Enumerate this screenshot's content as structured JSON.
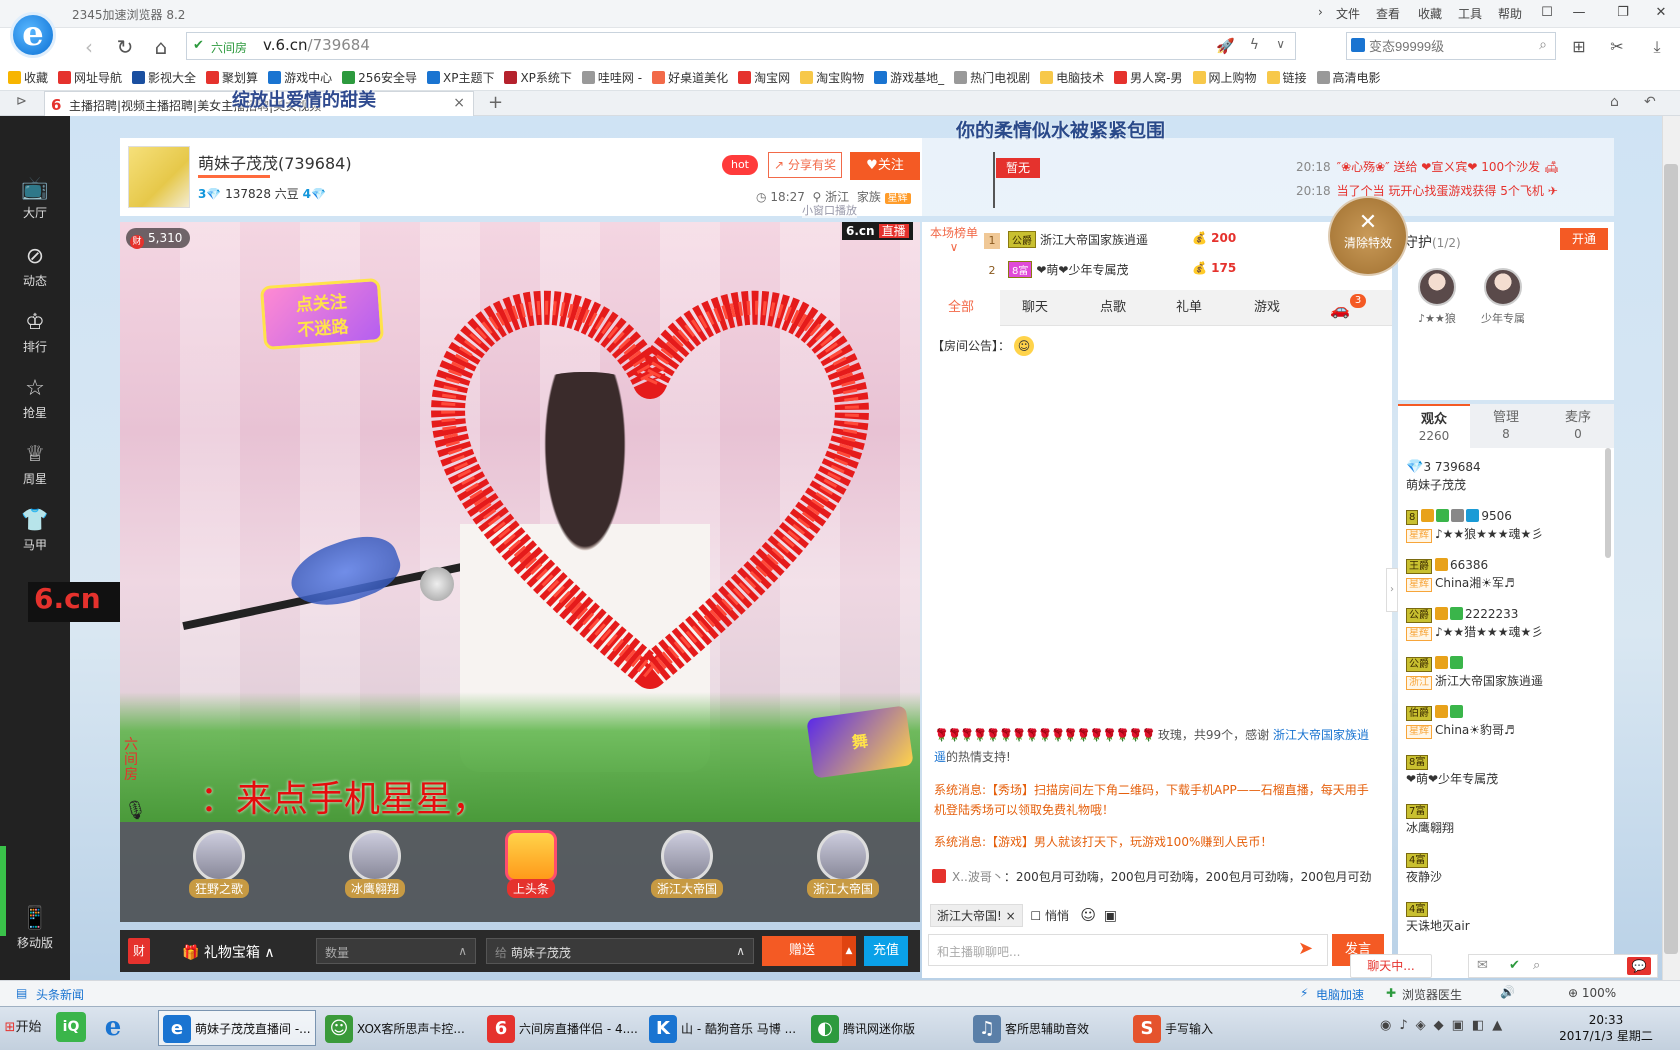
{
  "browser": {
    "title": "2345加速浏览器 8.2",
    "menu": [
      "文件",
      "查看",
      "收藏",
      "工具",
      "帮助"
    ],
    "site_label": "六间房",
    "url_host": "v.6.cn",
    "url_path": "/739684",
    "search_placeholder": "变态99999级",
    "tab_title": "主播招聘|视频主播招聘|美女主播招聘|美女视频",
    "tab_overlay": "绽放出爱情的甜美",
    "bookmarks": [
      "收藏",
      "网址导航",
      "影视大全",
      "聚划算",
      "游戏中心",
      "256安全导",
      "XP主题下",
      "XP系统下",
      "哇哇网 -",
      "好桌道美化",
      "淘宝网",
      "淘宝购物",
      "游戏基地_",
      "热门电视剧",
      "电脑技术",
      "男人窝-男",
      "网上购物",
      "链接",
      "高清电影"
    ],
    "bookmark_colors": [
      "#f7b500",
      "#e5322d",
      "#1a4fa0",
      "#e5322d",
      "#1a74d1",
      "#2d9a3e",
      "#1a74d1",
      "#b5222d",
      "#999",
      "#f26a49",
      "#e5322d",
      "#f7c84a",
      "#1a74d1",
      "#999",
      "#f7c84a",
      "#e5322d",
      "#f7c84a",
      "#f7c84a",
      "#999"
    ]
  },
  "leftnav": [
    "大厅",
    "动态",
    "排行",
    "抢星",
    "周星",
    "马甲"
  ],
  "leftnav_bottom": "移动版",
  "banner": "你的柔情似水被紧紧包围",
  "host": {
    "name": "萌妹子茂茂(739684)",
    "level": "3",
    "beans": "137828 六豆",
    "level2": "4",
    "time": "18:27",
    "location": "浙江",
    "family_label": "家族",
    "family_badge": "星辉",
    "hot": "hot",
    "share": "分享有奖",
    "follow": "关注",
    "small_window": "小窗口播放"
  },
  "video": {
    "viewers": "5,310",
    "brand": "6.cn",
    "live": "直播",
    "follow_sign_1": "点关注",
    "follow_sign_2": "不迷路",
    "subtitle": "：来点手机星星，",
    "watermark": "六间房"
  },
  "gift_rail": [
    "狂野之歌",
    "冰鹰翱翔",
    "上头条",
    "浙江大帝国",
    "浙江大帝国"
  ],
  "giftbar": {
    "icon": "财",
    "giftbox": "礼物宝箱",
    "qty_placeholder": "数量",
    "to_label": "给",
    "to_value": "萌妹子茂茂",
    "send": "赠送",
    "recharge": "充值"
  },
  "broadcast": {
    "flag": "暂无",
    "msgs": [
      {
        "time": "20:18",
        "text": "″❀心殇❀″ 送给 ❤宣ㄨ宾❤ 100个沙发"
      },
      {
        "time": "20:18",
        "text": "当了个当 玩开心找蛋游戏获得 5个飞机"
      }
    ]
  },
  "ranking": {
    "head": "本场榜单",
    "rows": [
      {
        "n": "1",
        "lv": "公爵",
        "name": "浙江大帝国家族逍遥",
        "pts": "200"
      },
      {
        "n": "2",
        "lv": "8富",
        "name": "❤萌❤少年专属茂",
        "pts": "175"
      }
    ]
  },
  "clear_effects": "清除特效",
  "chat": {
    "tabs": [
      "全部",
      "聊天",
      "点歌",
      "礼单",
      "游戏"
    ],
    "car_badge": "3",
    "announcement_label": "【房间公告】：",
    "roses_text": "玫瑰，共99个，感谢",
    "roses_user": "浙江大帝国家族逍遥",
    "roses_suffix": "的热情支持!",
    "sys1": "系统消息:【秀场】扫描房间左下角二维码，下载手机APP——石榴直播，每天用手机登陆秀场可以领取免费礼物哦！",
    "sys2": "系统消息:【游戏】男人就该打天下，玩游戏100%赚到人民币！",
    "marquee_user": "Ⅹ..波哥丶",
    "marquee_text": "：200包月可劲嗨，200包月可劲嗨，200包月可劲嗨，200包月可劲",
    "to_user": "浙江大帝国!",
    "whisper": "悄悄",
    "input_placeholder": "和主播聊聊吧...",
    "send": "发言"
  },
  "guard": {
    "title": "守护",
    "count": "(1/2)",
    "open": "开通",
    "members": [
      "♪★★狼",
      "少年专属"
    ]
  },
  "user_tabs": [
    {
      "label": "观众",
      "count": "2260"
    },
    {
      "label": "管理",
      "count": "8"
    },
    {
      "label": "麦序",
      "count": "0"
    }
  ],
  "users": [
    {
      "line1": "3 739684",
      "line2": "萌妹子茂茂"
    },
    {
      "line1": "9506",
      "line2": "♪★★狼★★★魂★彡",
      "lv": "8",
      "fam": "星辉"
    },
    {
      "line1": "66386",
      "line2": "China湘☀军♬",
      "lv": "王爵",
      "fam": "星辉"
    },
    {
      "line1": "2222233",
      "line2": "♪★★猎★★★魂★彡",
      "lv": "公爵",
      "fam": "星辉"
    },
    {
      "line1": "",
      "line2": "浙江大帝国家族逍遥",
      "lv": "公爵",
      "fam": "浙江"
    },
    {
      "line1": "",
      "line2": "China☀豹哥♬",
      "lv": "伯爵",
      "fam": "星辉"
    },
    {
      "line1": "",
      "line2": "❤萌❤少年专属茂",
      "lv": "8富"
    },
    {
      "line1": "",
      "line2": "冰鹰翱翔",
      "lv": "7富"
    },
    {
      "line1": "",
      "line2": "夜静沙",
      "lv": "4富"
    },
    {
      "line1": "",
      "line2": "天诛地灭air",
      "lv": "4富"
    }
  ],
  "chat_float": "聊天中...",
  "statusbar": {
    "news": "头条新闻",
    "accel": "电脑加速",
    "doctor": "浏览器医生",
    "zoom": "100%"
  },
  "taskbar": {
    "start": "开始",
    "items": [
      {
        "label": "萌妹子茂茂直播间 -...",
        "color": "#1a74d1",
        "glyph": "e"
      },
      {
        "label": "XOX客所思声卡控...",
        "color": "#3a9a3a",
        "glyph": "☺"
      },
      {
        "label": "六间房直播伴侣 - 4....",
        "color": "#e5322d",
        "glyph": "6"
      },
      {
        "label": "山 - 酷狗音乐 马博 ...",
        "color": "#1a74d1",
        "glyph": "K"
      },
      {
        "label": "腾讯网迷你版",
        "color": "#2d9a3e",
        "glyph": "◐"
      },
      {
        "label": "客所思辅助音效",
        "color": "#5a7fa8",
        "glyph": "♫"
      },
      {
        "label": "手写输入",
        "color": "#e5532d",
        "glyph": "S"
      }
    ],
    "time": "20:33",
    "date": "2017/1/3 星期二"
  }
}
